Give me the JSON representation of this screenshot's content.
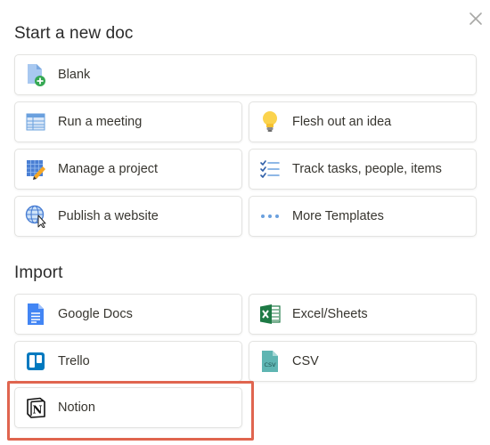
{
  "header": {
    "title": "Start a new doc",
    "close_icon": "close-icon"
  },
  "templates": {
    "blank": "Blank",
    "run_meeting": "Run a meeting",
    "flesh_out": "Flesh out an idea",
    "manage_project": "Manage a project",
    "track_tasks": "Track tasks, people, items",
    "publish_website": "Publish a website",
    "more_templates": "More Templates"
  },
  "import": {
    "title": "Import",
    "google_docs": "Google Docs",
    "excel": "Excel/Sheets",
    "trello": "Trello",
    "csv": "CSV",
    "csv_icon_text": "CSV",
    "notion": "Notion",
    "notion_icon_text": "N"
  },
  "colors": {
    "accent_blue": "#4a90e2",
    "excel_green": "#1e7a45",
    "trello_blue": "#0079bf",
    "csv_teal": "#4ba5a5",
    "highlight_red": "#e0654f"
  }
}
